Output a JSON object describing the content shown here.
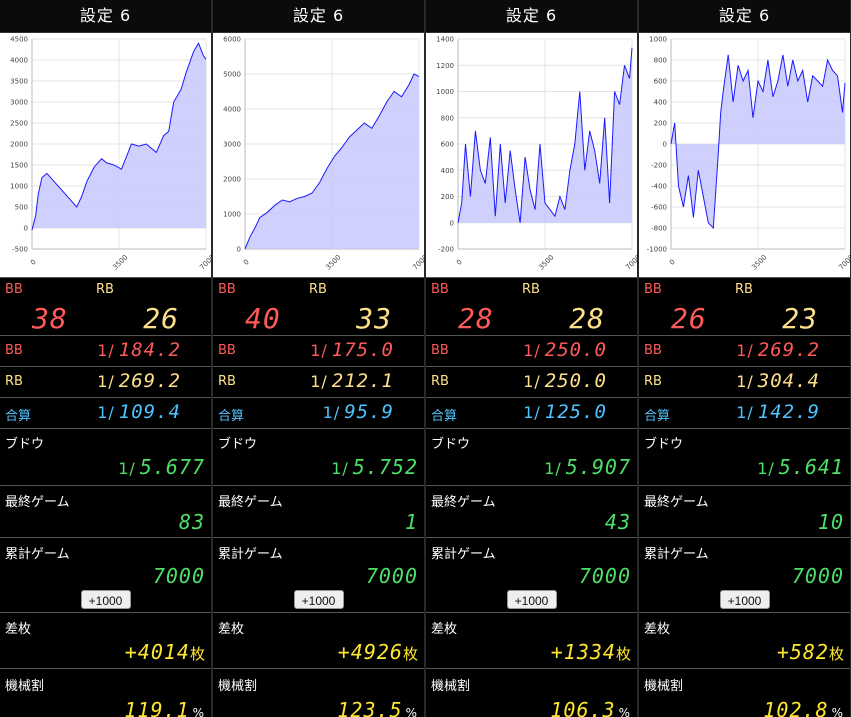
{
  "labels": {
    "bb": "BB",
    "rb": "RB",
    "total": "合算",
    "budou": "ブドウ",
    "last_game": "最終ゲーム",
    "total_game": "累計ゲーム",
    "diff": "差枚",
    "payout": "機械割",
    "prob_prefix": "1/",
    "coin_unit": "枚",
    "percent_unit": "%",
    "plus1000": "+1000"
  },
  "colors": {
    "bb": "#ff5a5a",
    "rb": "#ffe08a",
    "total": "#4fc3ff",
    "budou": "#4ddf66",
    "yellow": "#ffe62e",
    "line": "#1a1aff",
    "fill": "#c8c8ff"
  },
  "columns": [
    {
      "title": "設定 6",
      "bb_count": "38",
      "rb_count": "26",
      "bb_prob": "184.2",
      "rb_prob": "269.2",
      "total_prob": "109.4",
      "budou_prob": "5.677",
      "last_game": "83",
      "total_game": "7000",
      "diff": "+4014",
      "payout": "119.1"
    },
    {
      "title": "設定 6",
      "bb_count": "40",
      "rb_count": "33",
      "bb_prob": "175.0",
      "rb_prob": "212.1",
      "total_prob": "95.9",
      "budou_prob": "5.752",
      "last_game": "1",
      "total_game": "7000",
      "diff": "+4926",
      "payout": "123.5"
    },
    {
      "title": "設定 6",
      "bb_count": "28",
      "rb_count": "28",
      "bb_prob": "250.0",
      "rb_prob": "250.0",
      "total_prob": "125.0",
      "budou_prob": "5.907",
      "last_game": "43",
      "total_game": "7000",
      "diff": "+1334",
      "payout": "106.3"
    },
    {
      "title": "設定 6",
      "bb_count": "26",
      "rb_count": "23",
      "bb_prob": "269.2",
      "rb_prob": "304.4",
      "total_prob": "142.9",
      "budou_prob": "5.641",
      "last_game": "10",
      "total_game": "7000",
      "diff": "+582",
      "payout": "102.8"
    }
  ],
  "chart_data": [
    {
      "type": "area",
      "xlim": [
        0,
        7000
      ],
      "ylim": [
        -500,
        4500
      ],
      "x_ticks": [
        0,
        3500,
        7000
      ],
      "y_ticks": [
        -500,
        0,
        500,
        1000,
        1500,
        2000,
        2500,
        3000,
        3500,
        4000,
        4500
      ],
      "x": [
        0,
        150,
        250,
        400,
        600,
        900,
        1200,
        1500,
        1800,
        2000,
        2200,
        2500,
        2800,
        3000,
        3300,
        3600,
        3800,
        4000,
        4300,
        4600,
        5000,
        5300,
        5500,
        5700,
        6000,
        6200,
        6500,
        6700,
        6900,
        7000
      ],
      "y": [
        -50,
        300,
        800,
        1200,
        1300,
        1100,
        900,
        700,
        500,
        750,
        1100,
        1450,
        1650,
        1550,
        1500,
        1400,
        1700,
        2000,
        1950,
        2000,
        1800,
        2200,
        2300,
        3000,
        3300,
        3700,
        4200,
        4400,
        4100,
        4014
      ]
    },
    {
      "type": "area",
      "xlim": [
        0,
        7000
      ],
      "ylim": [
        0,
        6000
      ],
      "x_ticks": [
        0,
        3500,
        7000
      ],
      "y_ticks": [
        0,
        1000,
        2000,
        3000,
        4000,
        5000,
        6000
      ],
      "x": [
        0,
        200,
        400,
        600,
        900,
        1200,
        1500,
        1800,
        2100,
        2400,
        2700,
        3000,
        3300,
        3600,
        3900,
        4200,
        4500,
        4800,
        5100,
        5400,
        5700,
        6000,
        6300,
        6600,
        6800,
        7000
      ],
      "y": [
        0,
        350,
        600,
        900,
        1050,
        1250,
        1400,
        1350,
        1450,
        1500,
        1600,
        1900,
        2300,
        2650,
        2900,
        3200,
        3400,
        3600,
        3450,
        3800,
        4200,
        4500,
        4350,
        4700,
        5000,
        4926
      ]
    },
    {
      "type": "area",
      "xlim": [
        0,
        7000
      ],
      "ylim": [
        -200,
        1400
      ],
      "x_ticks": [
        0,
        3500,
        7000
      ],
      "y_ticks": [
        -200,
        0,
        200,
        400,
        600,
        800,
        1000,
        1200,
        1400
      ],
      "x": [
        0,
        150,
        300,
        500,
        700,
        900,
        1100,
        1300,
        1500,
        1700,
        1900,
        2100,
        2300,
        2500,
        2700,
        2900,
        3100,
        3300,
        3500,
        3700,
        3900,
        4100,
        4300,
        4500,
        4700,
        4900,
        5100,
        5300,
        5500,
        5700,
        5900,
        6100,
        6300,
        6500,
        6700,
        6900,
        7000
      ],
      "y": [
        0,
        150,
        600,
        200,
        700,
        400,
        300,
        650,
        50,
        600,
        150,
        550,
        250,
        0,
        500,
        250,
        100,
        600,
        150,
        100,
        50,
        200,
        100,
        400,
        600,
        1000,
        400,
        700,
        550,
        300,
        800,
        150,
        1000,
        900,
        1200,
        1100,
        1334
      ]
    },
    {
      "type": "area",
      "xlim": [
        0,
        7000
      ],
      "ylim": [
        -1000,
        1000
      ],
      "x_ticks": [
        0,
        3500,
        7000
      ],
      "y_ticks": [
        -1000,
        -800,
        -600,
        -400,
        -200,
        0,
        200,
        400,
        600,
        800,
        1000
      ],
      "x": [
        0,
        150,
        300,
        500,
        700,
        900,
        1100,
        1300,
        1500,
        1700,
        1900,
        2000,
        2100,
        2300,
        2500,
        2700,
        2900,
        3100,
        3300,
        3500,
        3700,
        3900,
        4100,
        4300,
        4500,
        4700,
        4900,
        5100,
        5300,
        5500,
        5700,
        5900,
        6100,
        6300,
        6500,
        6700,
        6900,
        7000
      ],
      "y": [
        0,
        200,
        -400,
        -600,
        -300,
        -700,
        -250,
        -500,
        -750,
        -800,
        -100,
        300,
        500,
        850,
        400,
        750,
        600,
        700,
        250,
        600,
        500,
        800,
        450,
        600,
        850,
        550,
        800,
        600,
        700,
        400,
        650,
        600,
        550,
        800,
        700,
        650,
        300,
        582
      ]
    }
  ]
}
